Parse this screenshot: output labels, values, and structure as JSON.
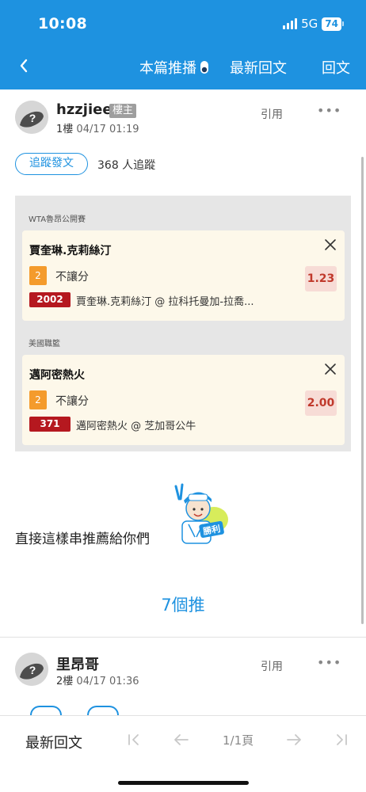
{
  "status_bar": {
    "time": "10:08",
    "network": "5G",
    "battery": "74"
  },
  "nav": {
    "back_icon": "chevron-left-icon",
    "push_broadcast": "本篇推播",
    "latest_reply": "最新回文",
    "reply": "回文"
  },
  "post1": {
    "author": "hzzjiee",
    "op_badge": "樓主",
    "floor": "1樓",
    "timestamp": "04/17 01:19",
    "quote": "引用",
    "more": "•••",
    "follow_button": "追蹤發文",
    "followers": "368 人追蹤",
    "parlay": [
      {
        "league": "WTA魯昂公開賽",
        "pick_title": "賈奎琳.克莉絲汀",
        "pick_number": "2",
        "pick_type": "不讓分",
        "odds": "1.23",
        "game_no": "2002",
        "matchup": "賈奎琳.克莉絲汀 @ 拉科托曼加-拉喬..."
      },
      {
        "league": "美國職籃",
        "pick_title": "邁阿密熱火",
        "pick_number": "2",
        "pick_type": "不讓分",
        "odds": "2.00",
        "game_no": "371",
        "matchup": "邁阿密熱火 @ 芝加哥公牛"
      }
    ],
    "text": "直接這樣串推薦給你們",
    "sticker_text": "勝利",
    "push_count": "7個推"
  },
  "post2": {
    "author": "里昂哥",
    "floor": "2樓",
    "timestamp": "04/17 01:36",
    "quote": "引用",
    "more": "•••"
  },
  "bottom_bar": {
    "latest_reply": "最新回文",
    "page_indicator": "1/1頁"
  },
  "colors": {
    "brand_blue": "#1e92e0",
    "pick_orange": "#f49b2c",
    "game_red": "#b5181f",
    "odds_bg": "#f7dcd6",
    "card_bg": "#fdf8ea"
  }
}
